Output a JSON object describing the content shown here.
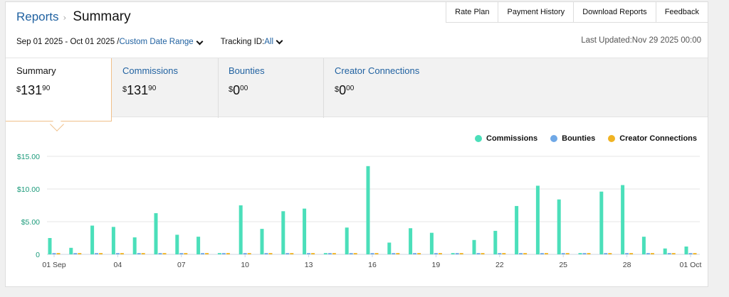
{
  "breadcrumb": {
    "root": "Reports",
    "separator": "›",
    "current": "Summary"
  },
  "topnav": {
    "items": [
      "Rate Plan",
      "Payment History",
      "Download Reports",
      "Feedback"
    ]
  },
  "filters": {
    "date_range": "Sep 01 2025 - Oct 01 2025 /",
    "date_range_link": "Custom Date Range",
    "tracking_prefix": "Tracking ID:",
    "tracking_value": "All"
  },
  "last_updated": "Last Updated:Nov 29 2025 00:00",
  "tabs": [
    {
      "label": "Summary",
      "currency": "$",
      "whole": "131",
      "fraction": "90"
    },
    {
      "label": "Commissions",
      "currency": "$",
      "whole": "131",
      "fraction": "90"
    },
    {
      "label": "Bounties",
      "currency": "$",
      "whole": "0",
      "fraction": "00"
    },
    {
      "label": "Creator Connections",
      "currency": "$",
      "whole": "0",
      "fraction": "00"
    }
  ],
  "legend": [
    {
      "label": "Commissions",
      "color": "#4bdfba"
    },
    {
      "label": "Bounties",
      "color": "#6fa8e6"
    },
    {
      "label": "Creator Connections",
      "color": "#f0b323"
    }
  ],
  "chart_data": {
    "type": "bar",
    "ylim": [
      0,
      15
    ],
    "yticks": [
      "$15.00",
      "$10.00",
      "$5.00",
      "0"
    ],
    "ytick_values": [
      15,
      10,
      5,
      0
    ],
    "xtick_labels": [
      "01 Sep",
      "04",
      "07",
      "10",
      "13",
      "16",
      "19",
      "22",
      "25",
      "28",
      "01 Oct"
    ],
    "xtick_index": [
      0,
      3,
      6,
      9,
      12,
      15,
      18,
      21,
      24,
      27,
      30
    ],
    "categories": [
      "01 Sep",
      "02",
      "03",
      "04",
      "05",
      "06",
      "07",
      "08",
      "09",
      "10",
      "11",
      "12",
      "13",
      "14",
      "15",
      "16",
      "17",
      "18",
      "19",
      "20",
      "21",
      "22",
      "23",
      "24",
      "25",
      "26",
      "27",
      "28",
      "29",
      "30",
      "01 Oct"
    ],
    "series": [
      {
        "name": "Commissions",
        "color": "#4bdfba",
        "values": [
          2.5,
          1.0,
          4.4,
          4.2,
          2.6,
          6.3,
          3.0,
          2.7,
          0.2,
          7.5,
          3.9,
          6.6,
          7.0,
          0.2,
          4.1,
          13.5,
          1.8,
          4.0,
          3.3,
          0.2,
          2.2,
          3.6,
          7.4,
          10.5,
          8.4,
          0.2,
          9.6,
          10.6,
          2.7,
          0.9,
          1.2
        ]
      },
      {
        "name": "Bounties",
        "color": "#6fa8e6",
        "values": [
          0.2,
          0.2,
          0.2,
          0.2,
          0.2,
          0.2,
          0.2,
          0.2,
          0.2,
          0.2,
          0.2,
          0.2,
          0.2,
          0.2,
          0.2,
          0.2,
          0.2,
          0.2,
          0.2,
          0.2,
          0.2,
          0.2,
          0.2,
          0.2,
          0.2,
          0.2,
          0.2,
          0.2,
          0.2,
          0.2,
          0.2
        ]
      },
      {
        "name": "Creator Connections",
        "color": "#f0b323",
        "values": [
          0.2,
          0.2,
          0.2,
          0.2,
          0.2,
          0.2,
          0.2,
          0.2,
          0.2,
          0.2,
          0.2,
          0.2,
          0.2,
          0.2,
          0.2,
          0.2,
          0.2,
          0.2,
          0.2,
          0.2,
          0.2,
          0.2,
          0.2,
          0.2,
          0.2,
          0.2,
          0.2,
          0.2,
          0.2,
          0.2,
          0.2
        ]
      }
    ],
    "ytick_color": "#1a9a7a",
    "grid": true
  }
}
